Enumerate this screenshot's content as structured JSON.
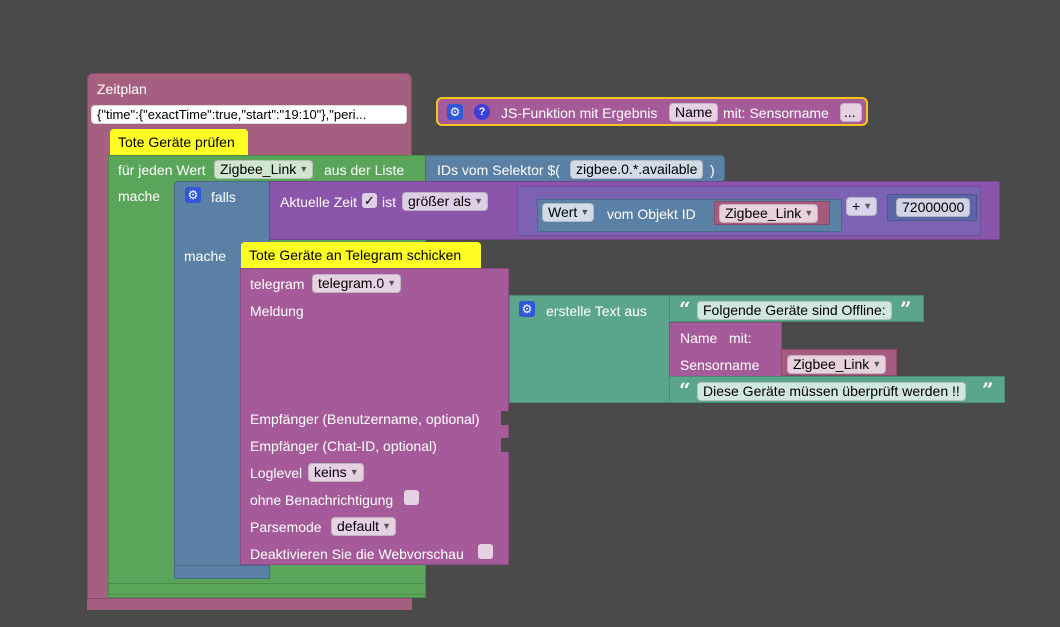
{
  "zeitplan": {
    "title": "Zeitplan",
    "schedule_value": "{\"time\":{\"exactTime\":true,\"start\":\"19:10\"},\"peri..."
  },
  "js_function": {
    "name_label": "JS-Funktion mit Ergebnis",
    "name_value": "Name",
    "params_label": "mit: Sensorname",
    "more": "..."
  },
  "comment_1": "Tote Geräte prüfen",
  "for_each": {
    "prefix": "für jeden Wert",
    "var": "Zigbee_Link",
    "suffix": "aus der Liste",
    "do": "mache"
  },
  "selector": {
    "label_prefix": "IDs vom Selektor $(",
    "value": "zigbee.0.*.available",
    "label_suffix": ")"
  },
  "if_block": {
    "falls": "falls",
    "mache": "mache"
  },
  "compare": {
    "time_label": "Aktuelle Zeit",
    "checked": "✓",
    "ist": "ist",
    "op": "größer als"
  },
  "value_of": {
    "attr": "Wert",
    "label": "vom Objekt ID",
    "var": "Zigbee_Link"
  },
  "math": {
    "op": "+",
    "number": "72000000"
  },
  "comment_2": "Tote Geräte an Telegram schicken",
  "telegram": {
    "label": "telegram",
    "instance": "telegram.0",
    "meldung": "Meldung",
    "recipient_user": "Empfänger (Benutzername, optional)",
    "recipient_chat": "Empfänger (Chat-ID, optional)",
    "loglevel_label": "Loglevel",
    "loglevel": "keins",
    "silent": "ohne Benachrichtigung",
    "parsemode_label": "Parsemode",
    "parsemode": "default",
    "disable_preview": "Deaktivieren Sie die Webvorschau"
  },
  "text_join": {
    "label": "erstelle Text aus",
    "text_1": "Folgende Geräte sind Offline:",
    "call_name": "Name",
    "call_mit": "mit:",
    "param_label": "Sensorname",
    "param_var": "Zigbee_Link",
    "text_2": "Diese Geräte müssen überprüft werden !!",
    "quote_open": "“",
    "quote_close": "”"
  },
  "colors": {
    "background": "#4a4a4a",
    "zeitplan": "#a5607f",
    "loop": "#5ba55b",
    "logic": "#5b80a5",
    "compare_purple": "#8a55aa",
    "telegram": "#a55b99",
    "text_green": "#5ba58c",
    "comment": "#ffff24"
  }
}
